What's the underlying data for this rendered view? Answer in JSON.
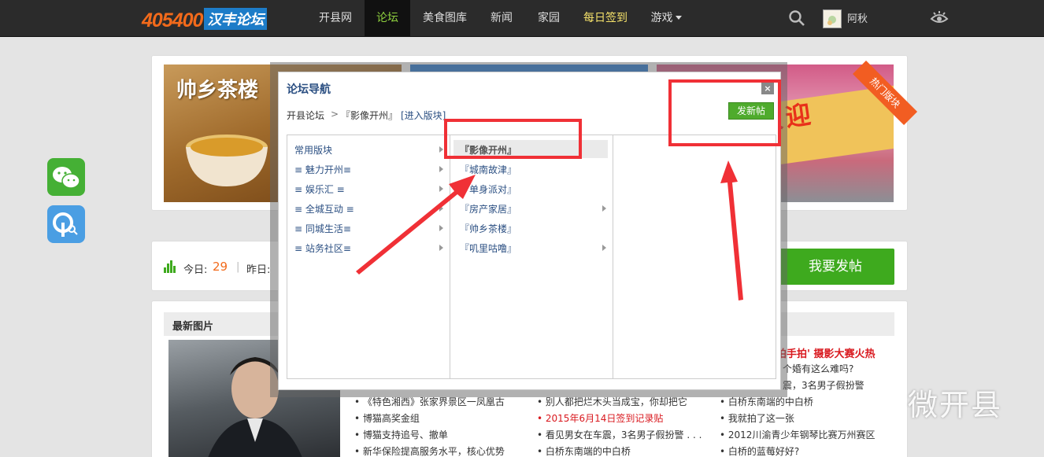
{
  "header": {
    "logo_main": "405400",
    "logo_sub": "汉丰论坛",
    "nav": [
      {
        "label": "开县网"
      },
      {
        "label": "论坛"
      },
      {
        "label": "美食图库"
      },
      {
        "label": "新闻"
      },
      {
        "label": "家园"
      },
      {
        "label": "每日签到"
      },
      {
        "label": "游戏"
      }
    ],
    "username": "阿秋"
  },
  "banners": {
    "left_text": "帅乡茶楼",
    "right_text": "美食街欢迎",
    "hot_ribbon": "热门版块"
  },
  "stats": {
    "today_label": "今日:",
    "today_value": "29",
    "separator": "|",
    "yesterday_label": "昨日:"
  },
  "post_button": "我要发帖",
  "latest_images": "最新图片",
  "news": {
    "col1": [
      "《特色湘西》张家界景区一凤凰古",
      "博猫高奖金组",
      "博猫支持追号、撤单",
      "新华保险提高服务水平，核心优势"
    ],
    "col2": [
      "别人都把烂木头当成宝，你却把它",
      "2015年6月14日签到记录贴",
      "看见男女在车震，3名男子假扮警 . . .",
      "白桥东南端的中白桥"
    ],
    "col3_hot": "拍手拍' 摄影大赛火热",
    "col3": [
      "个婚有这么难吗?",
      "震，3名男子假扮警",
      "白桥东南端的中白桥",
      "我就拍了这一张",
      "2012川渝青少年钢琴比赛万州赛区",
      "白桥的蓝莓好好?"
    ]
  },
  "watermark": "微开县",
  "dialog": {
    "title": "论坛导航",
    "close": "×",
    "breadcrumb_root": "开县论坛",
    "breadcrumb_sep": ">",
    "breadcrumb_current": "『影像开州』",
    "enter_link": "[进入版块]",
    "new_post": "发新帖",
    "categories": [
      {
        "label": "常用版块"
      },
      {
        "label": "≡ 魅力开州≡"
      },
      {
        "label": "≡ 娱乐汇 ≡"
      },
      {
        "label": "≡ 全城互动 ≡"
      },
      {
        "label": "≡ 同城生活≡"
      },
      {
        "label": "≡ 站务社区≡"
      }
    ],
    "forums": [
      {
        "label": "『影像开州』"
      },
      {
        "label": "『城南故津』"
      },
      {
        "label": "『单身派对』"
      },
      {
        "label": "『房产家居』"
      },
      {
        "label": "『帅乡茶楼』"
      },
      {
        "label": "『叽里咕噜』"
      }
    ]
  },
  "colors": {
    "nav_bg": "#2b2b2b",
    "nav_active": "#8fd13f",
    "link_blue": "#2b4f82",
    "green_button": "#3eaa1e",
    "annotation_red": "#f03036",
    "logo_orange": "#f26a1b"
  }
}
